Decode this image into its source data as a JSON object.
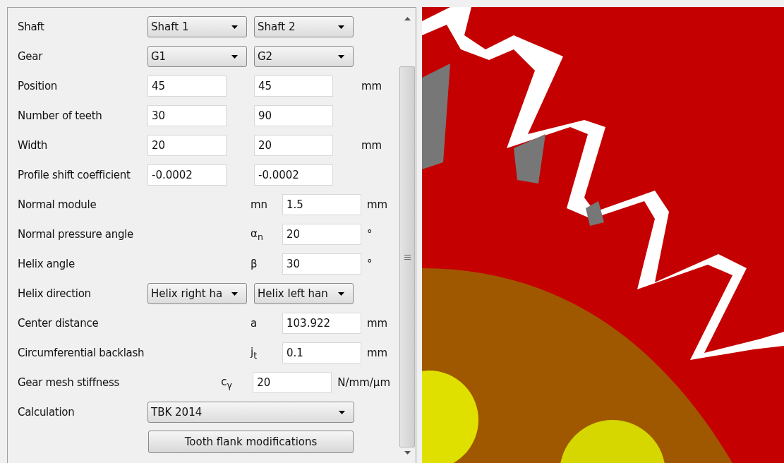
{
  "rows": [
    {
      "kind": "pair_combo",
      "label": "Shaft",
      "values": [
        "Shaft 1",
        "Shaft 2"
      ]
    },
    {
      "kind": "pair_combo",
      "label": "Gear",
      "values": [
        "G1",
        "G2"
      ]
    },
    {
      "kind": "pair_input",
      "label": "Position",
      "values": [
        "45",
        "45"
      ],
      "unit": "mm"
    },
    {
      "kind": "pair_input",
      "label": "Number of teeth",
      "values": [
        "30",
        "90"
      ]
    },
    {
      "kind": "pair_input",
      "label": "Width",
      "values": [
        "20",
        "20"
      ],
      "unit": "mm"
    },
    {
      "kind": "pair_input",
      "label": "Profile shift coefficient",
      "values": [
        "-0.0002",
        "-0.0002"
      ]
    },
    {
      "kind": "single_input",
      "label": "Normal module",
      "symbol": "mn",
      "value": "1.5",
      "unit": "mm"
    },
    {
      "kind": "single_input",
      "label": "Normal pressure angle",
      "symbol": "α$_{n}$",
      "value": "20",
      "unit": "°"
    },
    {
      "kind": "single_input",
      "label": "Helix angle",
      "symbol": "β",
      "value": "30",
      "unit": "°"
    },
    {
      "kind": "pair_combo",
      "label": "Helix direction",
      "values": [
        "Helix right ha",
        "Helix left han"
      ]
    },
    {
      "kind": "single_input",
      "label": "Center distance",
      "symbol": "a",
      "value": "103.922",
      "unit": "mm"
    },
    {
      "kind": "single_input",
      "label": "Circumferential backlash",
      "symbol": "j$_{t}$",
      "value": "0.1",
      "unit": "mm"
    },
    {
      "kind": "single_input",
      "label": "Gear mesh stiffness",
      "symbol": "c$_{γ}$",
      "value": "20",
      "unit": "N/mm/µm"
    },
    {
      "kind": "wide_combo",
      "label": "Calculation",
      "value": "TBK 2014"
    },
    {
      "kind": "button",
      "label": "Tooth flank modifications"
    }
  ]
}
